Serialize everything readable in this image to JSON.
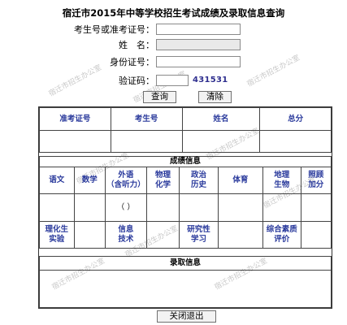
{
  "page": {
    "title": "宿迁市2015年中等学校招生考试成绩及录取信息查询"
  },
  "form": {
    "exam_no_label": "考生号或准考证号：",
    "name_label": "姓　名：",
    "id_label": "身份证号：",
    "captcha_label": "验证码：",
    "captcha_value": "431531",
    "exam_no_value": "",
    "name_value": "",
    "id_value": "",
    "captcha_input_value": ""
  },
  "buttons": {
    "query": "查询",
    "clear": "清除",
    "close": "关闭退出"
  },
  "basic_info": {
    "headers": [
      "准考证号",
      "考生号",
      "姓名",
      "总分"
    ],
    "values": [
      "",
      "",
      "",
      ""
    ]
  },
  "scores": {
    "section_title": "成绩信息",
    "row1_headers": [
      "语文",
      "数学",
      "外语\n（含听力）",
      "物理\n化学",
      "政治\n历史",
      "体育",
      "地理\n生物",
      "照顾\n加分"
    ],
    "foreign_lang_value": "（ ）",
    "row2_headers": [
      "理化生\n实验",
      "信息\n技术",
      "研究性\n学习",
      "综合素质\n评价"
    ]
  },
  "admission": {
    "section_title": "录取信息",
    "value": ""
  },
  "colors": {
    "header_text": "#2a3a9c",
    "captcha_text": "#2f2f8f"
  }
}
